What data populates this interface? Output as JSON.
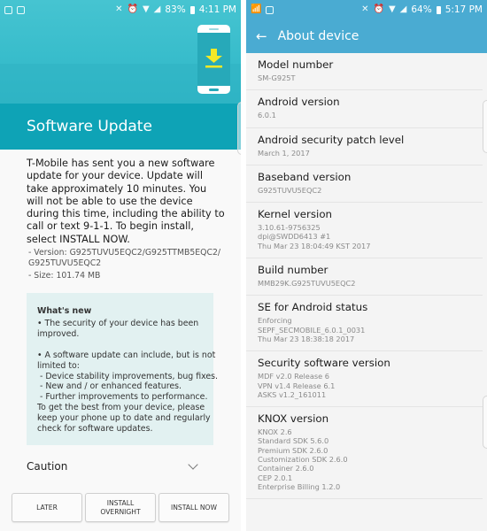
{
  "software_update": {
    "status_bar": {
      "left_icons": [
        "tablet-notification-icon",
        "image-notification-icon"
      ],
      "right_icons": [
        "nfc-mute-icon",
        "alarm-icon",
        "wifi-icon",
        "signal-icon"
      ],
      "battery": "83%",
      "time": "4:11 PM"
    },
    "title": "Software Update",
    "hero_icon": "phone-download-icon",
    "message": "T-Mobile has sent you a new software update for your device. Update will take approximately 10 minutes. You will not be able to use the device during this time, including the ability to call or text 9-1-1. To begin install, select INSTALL NOW.",
    "details": [
      " - Version: G925TUVU5EQC2/G925TTMB5EQC2/",
      "G925TUVU5EQC2",
      " - Size: 101.74 MB"
    ],
    "whats_new": {
      "title": "What's new",
      "lines": [
        "• The security of your device has been",
        "improved.",
        "",
        "• A software update can include, but is not",
        "limited to:",
        " - Device stability improvements, bug fixes.",
        " - New and / or enhanced features.",
        " - Further improvements to performance.",
        "To get the best from your device, please",
        "keep your phone up to date and regularly",
        "check for software updates."
      ]
    },
    "caution_label": "Caution",
    "buttons": {
      "later": "LATER",
      "install_overnight": "INSTALL OVERNIGHT",
      "install_now": "INSTALL NOW"
    },
    "colors": {
      "header": "#37bccb",
      "titlebar": "#0ea3b6",
      "whats_new_bg": "#e2f1f1",
      "download_arrow": "#f5e926"
    }
  },
  "about_device": {
    "status_bar": {
      "left_icons": [
        "wifi-calling-icon",
        "image-notification-icon"
      ],
      "right_icons": [
        "nfc-mute-icon",
        "alarm-icon",
        "wifi-icon",
        "signal-icon"
      ],
      "battery": "64%",
      "time": "5:17 PM"
    },
    "title": "About device",
    "items": [
      {
        "label": "Model number",
        "value": "SM-G925T"
      },
      {
        "label": "Android version",
        "value": "6.0.1"
      },
      {
        "label": "Android security patch level",
        "value": "March 1, 2017"
      },
      {
        "label": "Baseband version",
        "value": "G925TUVU5EQC2"
      },
      {
        "label": "Kernel version",
        "value": "3.10.61-9756325\ndpi@SWDD6413 #1\nThu Mar 23 18:04:49 KST 2017"
      },
      {
        "label": "Build number",
        "value": "MMB29K.G925TUVU5EQC2"
      },
      {
        "label": "SE for Android status",
        "value": "Enforcing\nSEPF_SECMOBILE_6.0.1_0031\nThu Mar 23 18:38:18 2017"
      },
      {
        "label": "Security software version",
        "value": "MDF v2.0 Release 6\nVPN v1.4 Release 6.1\nASKS v1.2_161011"
      },
      {
        "label": "KNOX version",
        "value": "KNOX 2.6\nStandard SDK 5.6.0\nPremium SDK 2.6.0\nCustomization SDK 2.6.0\nContainer 2.6.0\nCEP 2.0.1\nEnterprise Billing 1.2.0"
      }
    ],
    "colors": {
      "header": "#4aabd2"
    }
  }
}
